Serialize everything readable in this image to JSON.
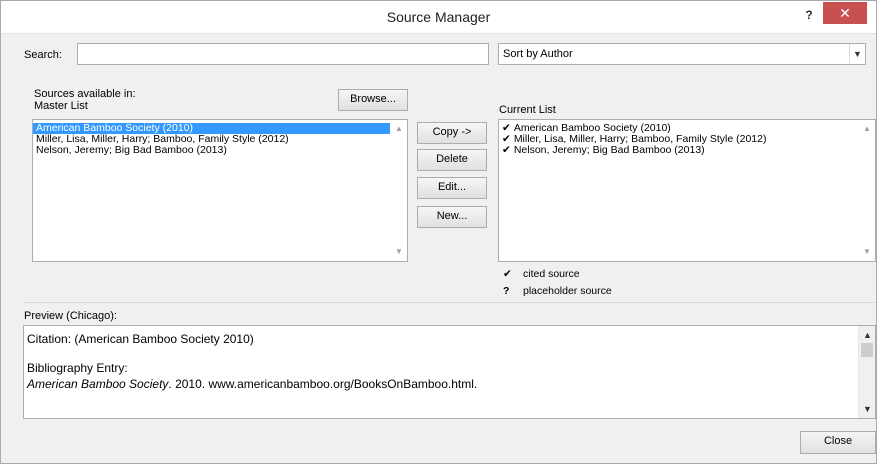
{
  "window": {
    "title": "Source Manager",
    "help": "?",
    "close": "✕"
  },
  "search": {
    "label": "Search:",
    "value": "",
    "placeholder": ""
  },
  "sort": {
    "selected": "Sort by Author"
  },
  "master": {
    "caption_line1": "Sources available in:",
    "caption_line2": "Master List",
    "browse_label": "Browse...",
    "items": [
      "American Bamboo Society (2010)",
      "Miller, Lisa, Miller, Harry; Bamboo, Family Style (2012)",
      "Nelson, Jeremy; Big Bad Bamboo (2013)"
    ]
  },
  "actions": {
    "copy": "Copy ->",
    "delete": "Delete",
    "edit": "Edit...",
    "new": "New..."
  },
  "current": {
    "caption": "Current List",
    "items": [
      "American Bamboo Society (2010)",
      "Miller, Lisa, Miller, Harry; Bamboo, Family Style (2012)",
      "Nelson, Jeremy; Big Bad Bamboo (2013)"
    ],
    "check_symbol": "✔"
  },
  "legend": {
    "cited_symbol": "✔",
    "cited_label": "cited source",
    "placeholder_symbol": "?",
    "placeholder_label": "placeholder source"
  },
  "preview": {
    "caption": "Preview (Chicago):",
    "citation": "Citation:  (American Bamboo Society 2010)",
    "bibliography_heading": "Bibliography Entry:",
    "bibliography_title": "American Bamboo Society",
    "bibliography_rest": ". 2010. www.americanbamboo.org/BooksOnBamboo.html."
  },
  "footer": {
    "close_label": "Close"
  }
}
